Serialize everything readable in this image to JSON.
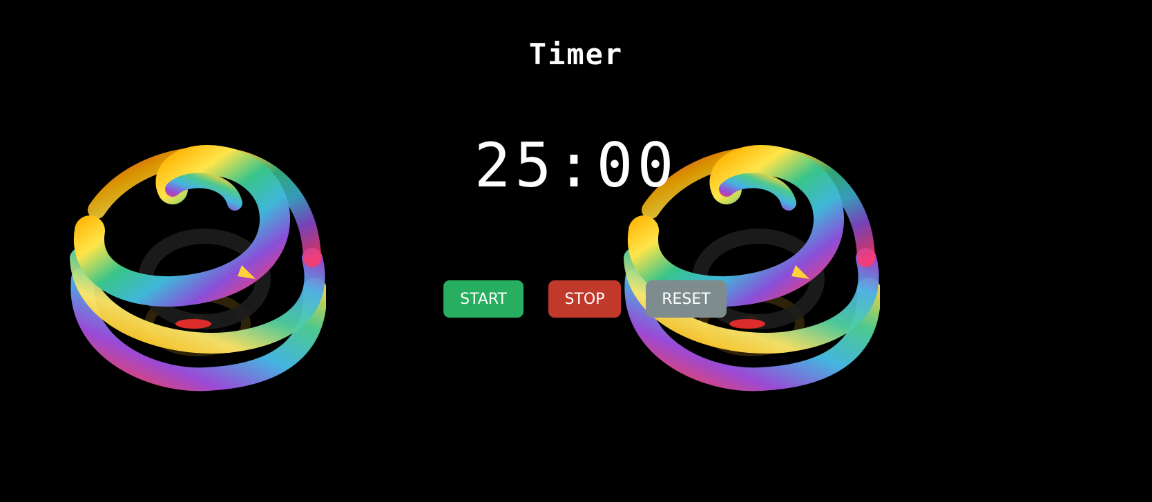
{
  "app": {
    "title": "Timer"
  },
  "timer": {
    "display": "25:00"
  },
  "controls": {
    "start_label": "START",
    "stop_label": "STOP",
    "reset_label": "RESET"
  },
  "colors": {
    "background": "#000000",
    "text": "#ffffff",
    "start": "#27ae60",
    "stop": "#c0392b",
    "reset": "#7f8c8d"
  },
  "decorations": {
    "left": "rainbow-spiral-sphere-image",
    "right": "rainbow-spiral-sphere-image"
  }
}
